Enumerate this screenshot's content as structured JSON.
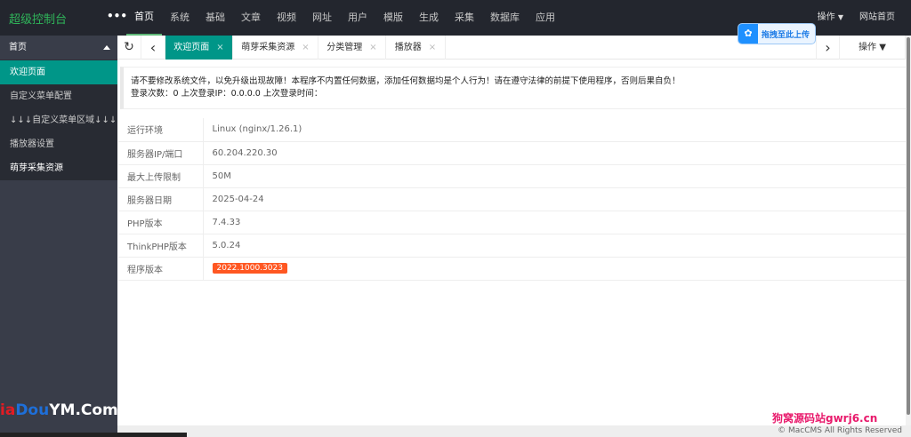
{
  "header": {
    "logo": "超级控制台",
    "more": "•••",
    "nav": [
      "首页",
      "系统",
      "基础",
      "文章",
      "视频",
      "网址",
      "用户",
      "模版",
      "生成",
      "采集",
      "数据库",
      "应用"
    ],
    "ops": "操作",
    "ops_caret": "▼",
    "home": "网站首页"
  },
  "sidebar": {
    "title": "首页",
    "items": [
      "欢迎页面",
      "自定义菜单配置",
      "↓↓↓自定义菜单区域↓↓↓",
      "播放器设置",
      "萌芽采集资源"
    ]
  },
  "tabs": {
    "refresh": "↻",
    "prev": "‹",
    "next": "›",
    "items": [
      "欢迎页面",
      "萌芽采集资源",
      "分类管理",
      "播放器"
    ],
    "close": "×",
    "ops": "操作 ▼"
  },
  "upload": {
    "icon": "cloud-icon",
    "label": "拖拽至此上传"
  },
  "notice": {
    "line1": "请不要修改系统文件，以免升级出现故障！本程序不内置任何数据，添加任何数据均是个人行为！请在遵守法律的前提下使用程序，否则后果自负！",
    "line2": "登录次数：0 上次登录IP：0.0.0.0 上次登录时间："
  },
  "info": [
    {
      "label": "运行环境",
      "value": "Linux (nginx/1.26.1)"
    },
    {
      "label": "服务器IP/端口",
      "value": "60.204.220.30"
    },
    {
      "label": "最大上传限制",
      "value": "50M"
    },
    {
      "label": "服务器日期",
      "value": "2025-04-24"
    },
    {
      "label": "PHP版本",
      "value": "7.4.33"
    },
    {
      "label": "ThinkPHP版本",
      "value": "5.0.24"
    },
    {
      "label": "程序版本",
      "value": "2022.1000.3023"
    }
  ],
  "watermarks": {
    "left_a": "i",
    "left_b": "a",
    "left_c": "Dou",
    "left_d": "YM.Com",
    "right": "狗窝源码站gwrj6.cn"
  },
  "footer": "© MacCMS All Rights Reserved",
  "colors": {
    "accent": "#009688",
    "header": "#23262e",
    "badge": "#ff5722"
  }
}
